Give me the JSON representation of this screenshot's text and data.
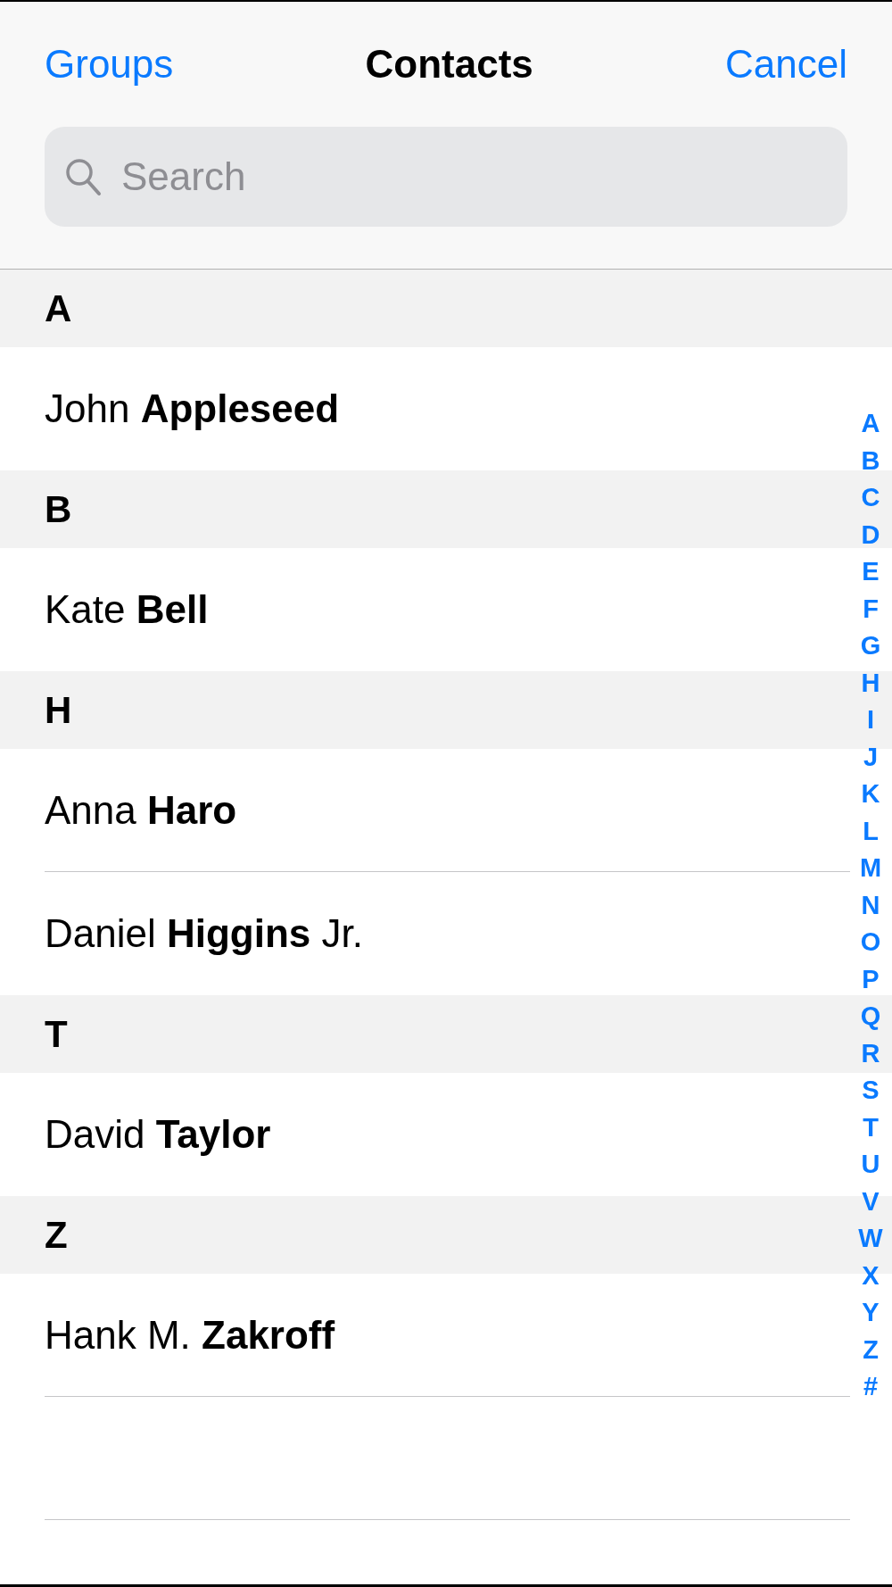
{
  "nav": {
    "left_button": "Groups",
    "title": "Contacts",
    "right_button": "Cancel"
  },
  "search": {
    "placeholder": "Search"
  },
  "sections": [
    {
      "letter": "A",
      "contacts": [
        "John **Appleseed**"
      ]
    },
    {
      "letter": "B",
      "contacts": [
        "Kate **Bell**"
      ]
    },
    {
      "letter": "H",
      "contacts": [
        "Anna **Haro**",
        "Daniel **Higgins** Jr."
      ]
    },
    {
      "letter": "T",
      "contacts": [
        "David **Taylor**"
      ]
    },
    {
      "letter": "Z",
      "contacts": [
        "Hank M. **Zakroff**"
      ]
    }
  ],
  "index": [
    "A",
    "B",
    "C",
    "D",
    "E",
    "F",
    "G",
    "H",
    "I",
    "J",
    "K",
    "L",
    "M",
    "N",
    "O",
    "P",
    "Q",
    "R",
    "S",
    "T",
    "U",
    "V",
    "W",
    "X",
    "Y",
    "Z",
    "#"
  ]
}
